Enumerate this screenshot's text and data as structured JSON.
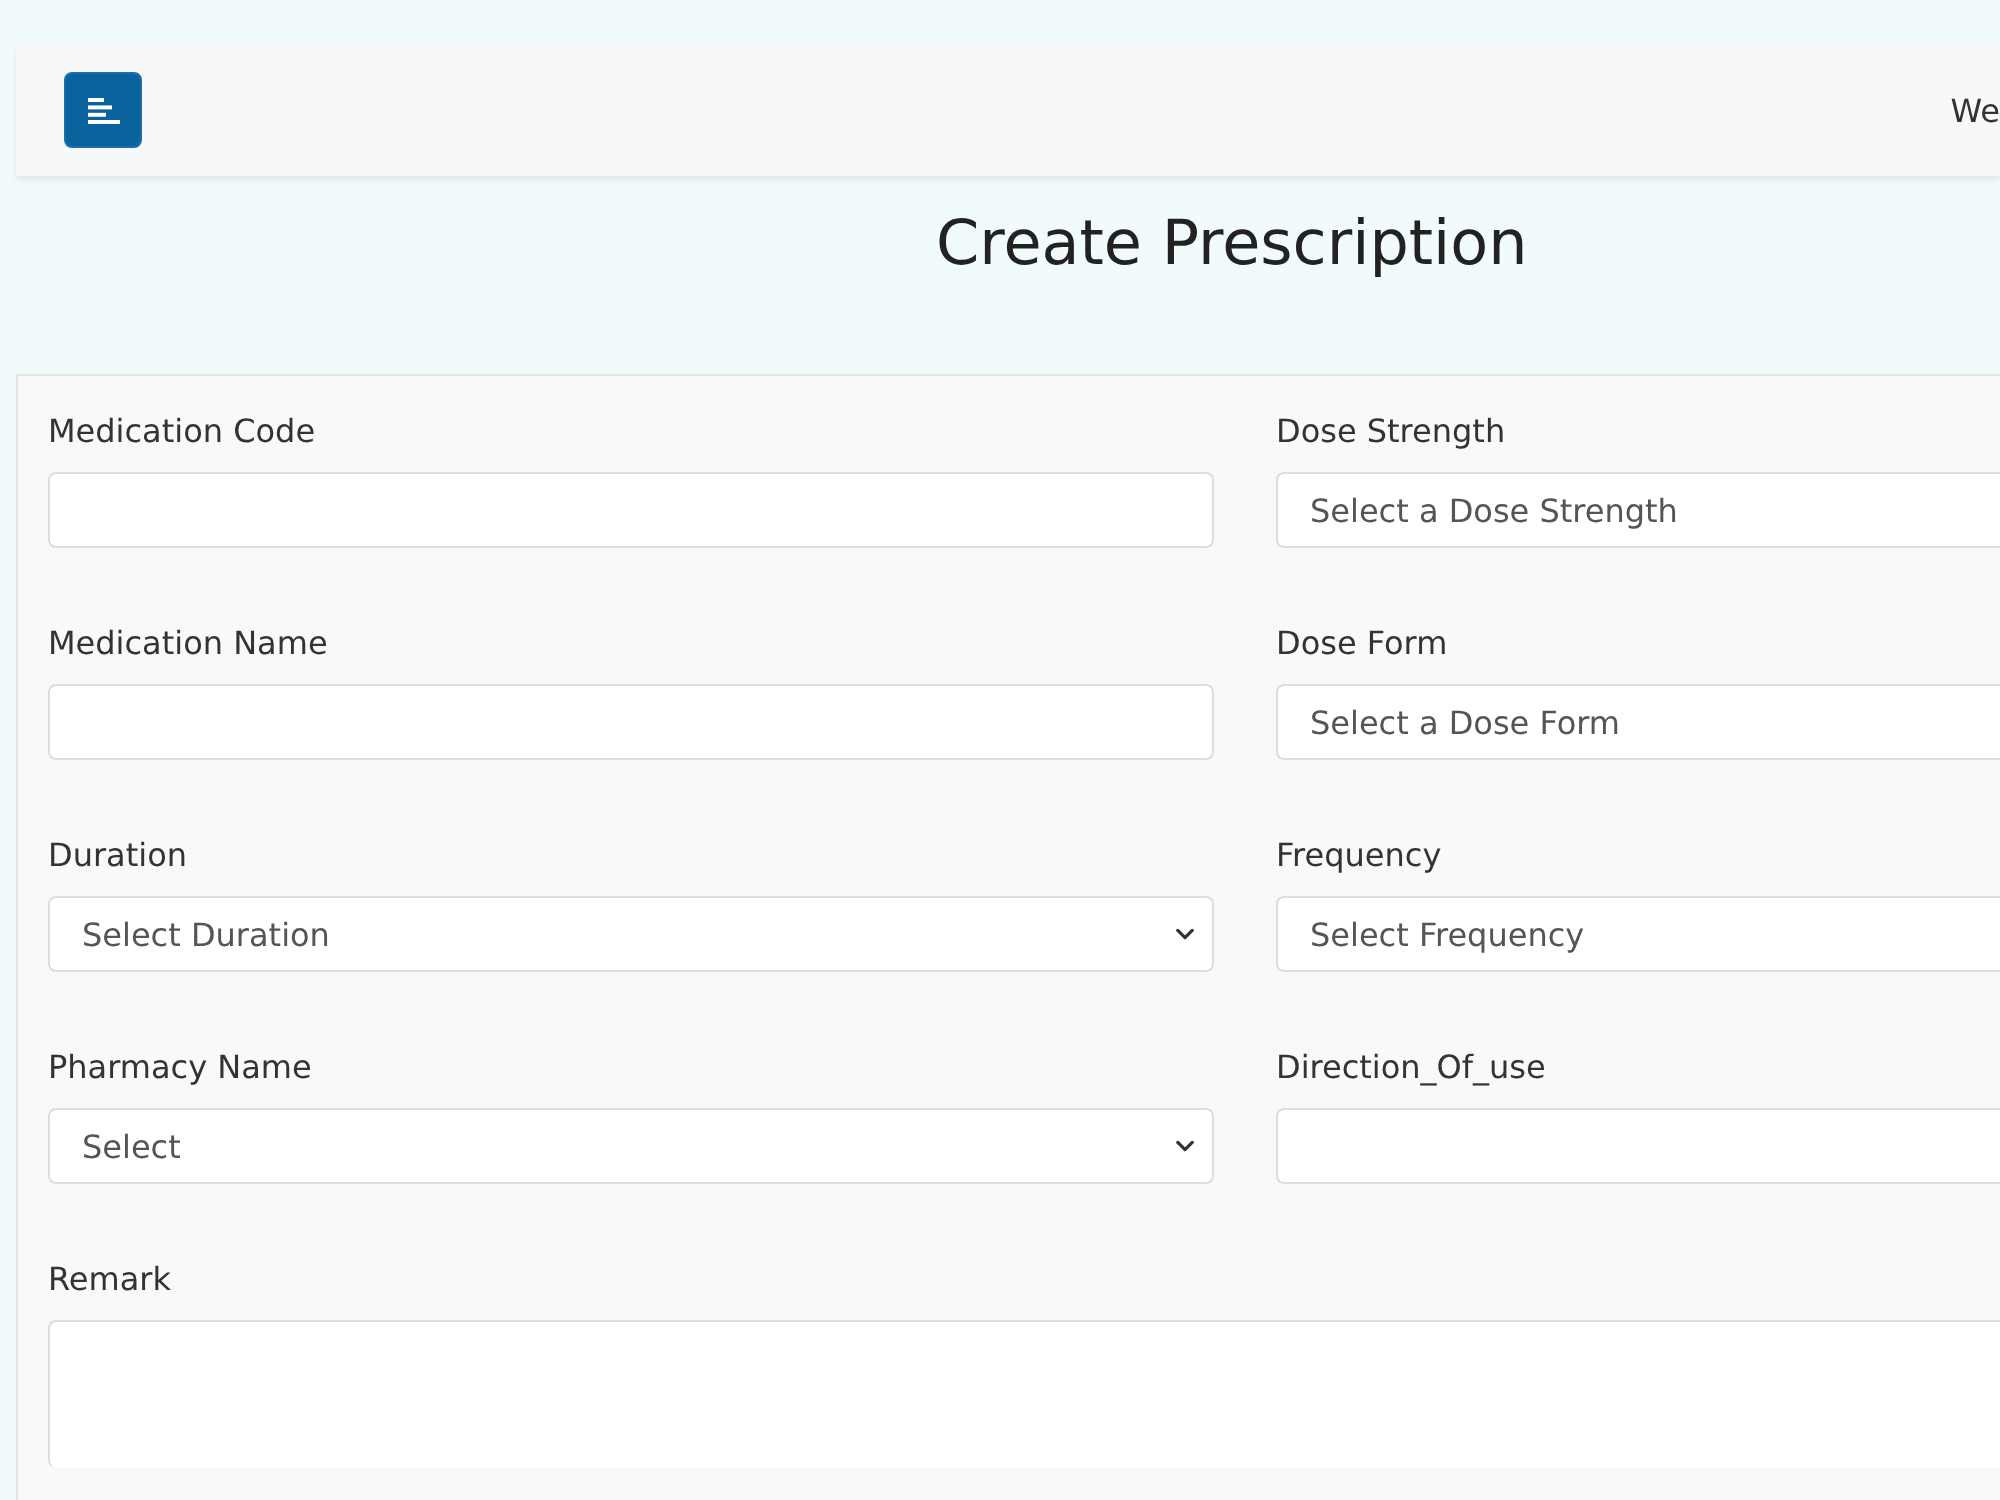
{
  "header": {
    "greeting": "We"
  },
  "title": "Create Prescription",
  "fields": [
    {
      "label": "Medication Code",
      "kind": "input"
    },
    {
      "label": "Dose Strength",
      "kind": "select",
      "placeholder": "Select a Dose Strength",
      "arrow": false
    },
    {
      "label": "Medication Name",
      "kind": "input"
    },
    {
      "label": "Dose Form",
      "kind": "select",
      "placeholder": "Select a Dose Form",
      "arrow": false
    },
    {
      "label": "Duration",
      "kind": "select",
      "placeholder": "Select Duration",
      "arrow": true
    },
    {
      "label": "Frequency",
      "kind": "select",
      "placeholder": "Select Frequency",
      "arrow": false
    },
    {
      "label": "Pharmacy Name",
      "kind": "select",
      "placeholder": "Select",
      "arrow": true
    },
    {
      "label": "Direction_Of_use",
      "kind": "input"
    },
    {
      "label": "Remark",
      "kind": "textarea"
    }
  ]
}
